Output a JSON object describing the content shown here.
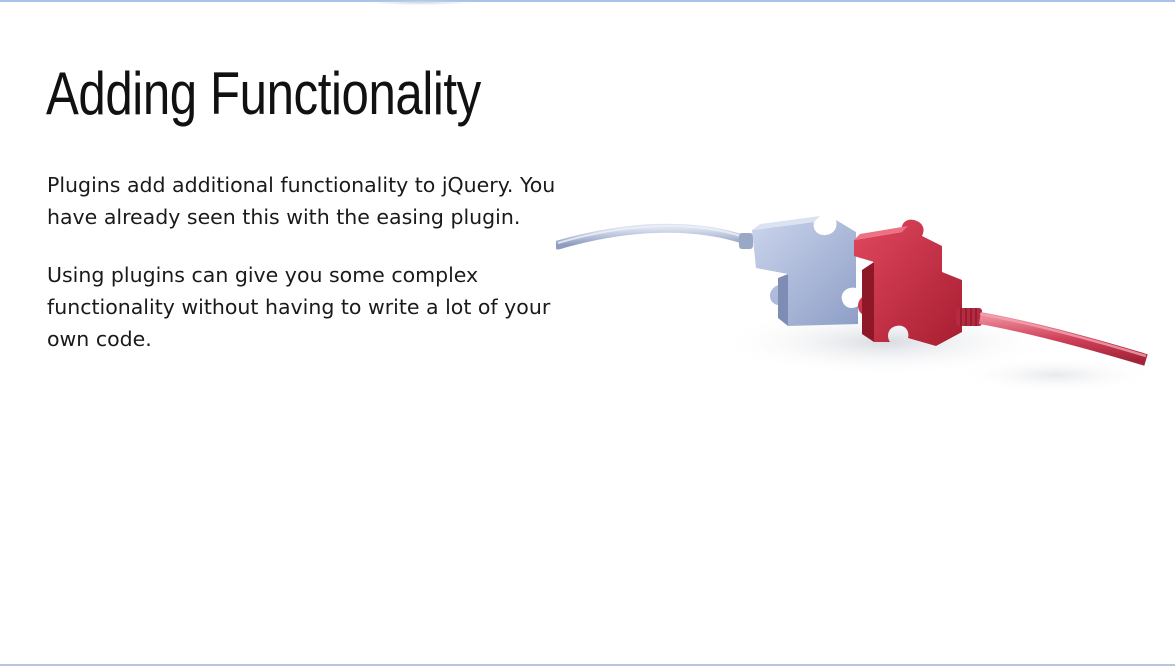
{
  "slide": {
    "title": "Adding Functionality",
    "paragraphs": [
      "Plugins add additional functionality to jQuery. You have already seen this with the easing plugin.",
      "Using plugins can give you some complex functionality without having to write a lot of your own code."
    ]
  },
  "image": {
    "name": "puzzle-plug-connector",
    "left_piece_color": "#a7b6d9",
    "right_piece_color": "#c8283e",
    "left_cable_color": "#b9c4dc",
    "right_cable_color": "#d0405a"
  },
  "frame": {
    "accent_color": "#a9c3e8"
  }
}
